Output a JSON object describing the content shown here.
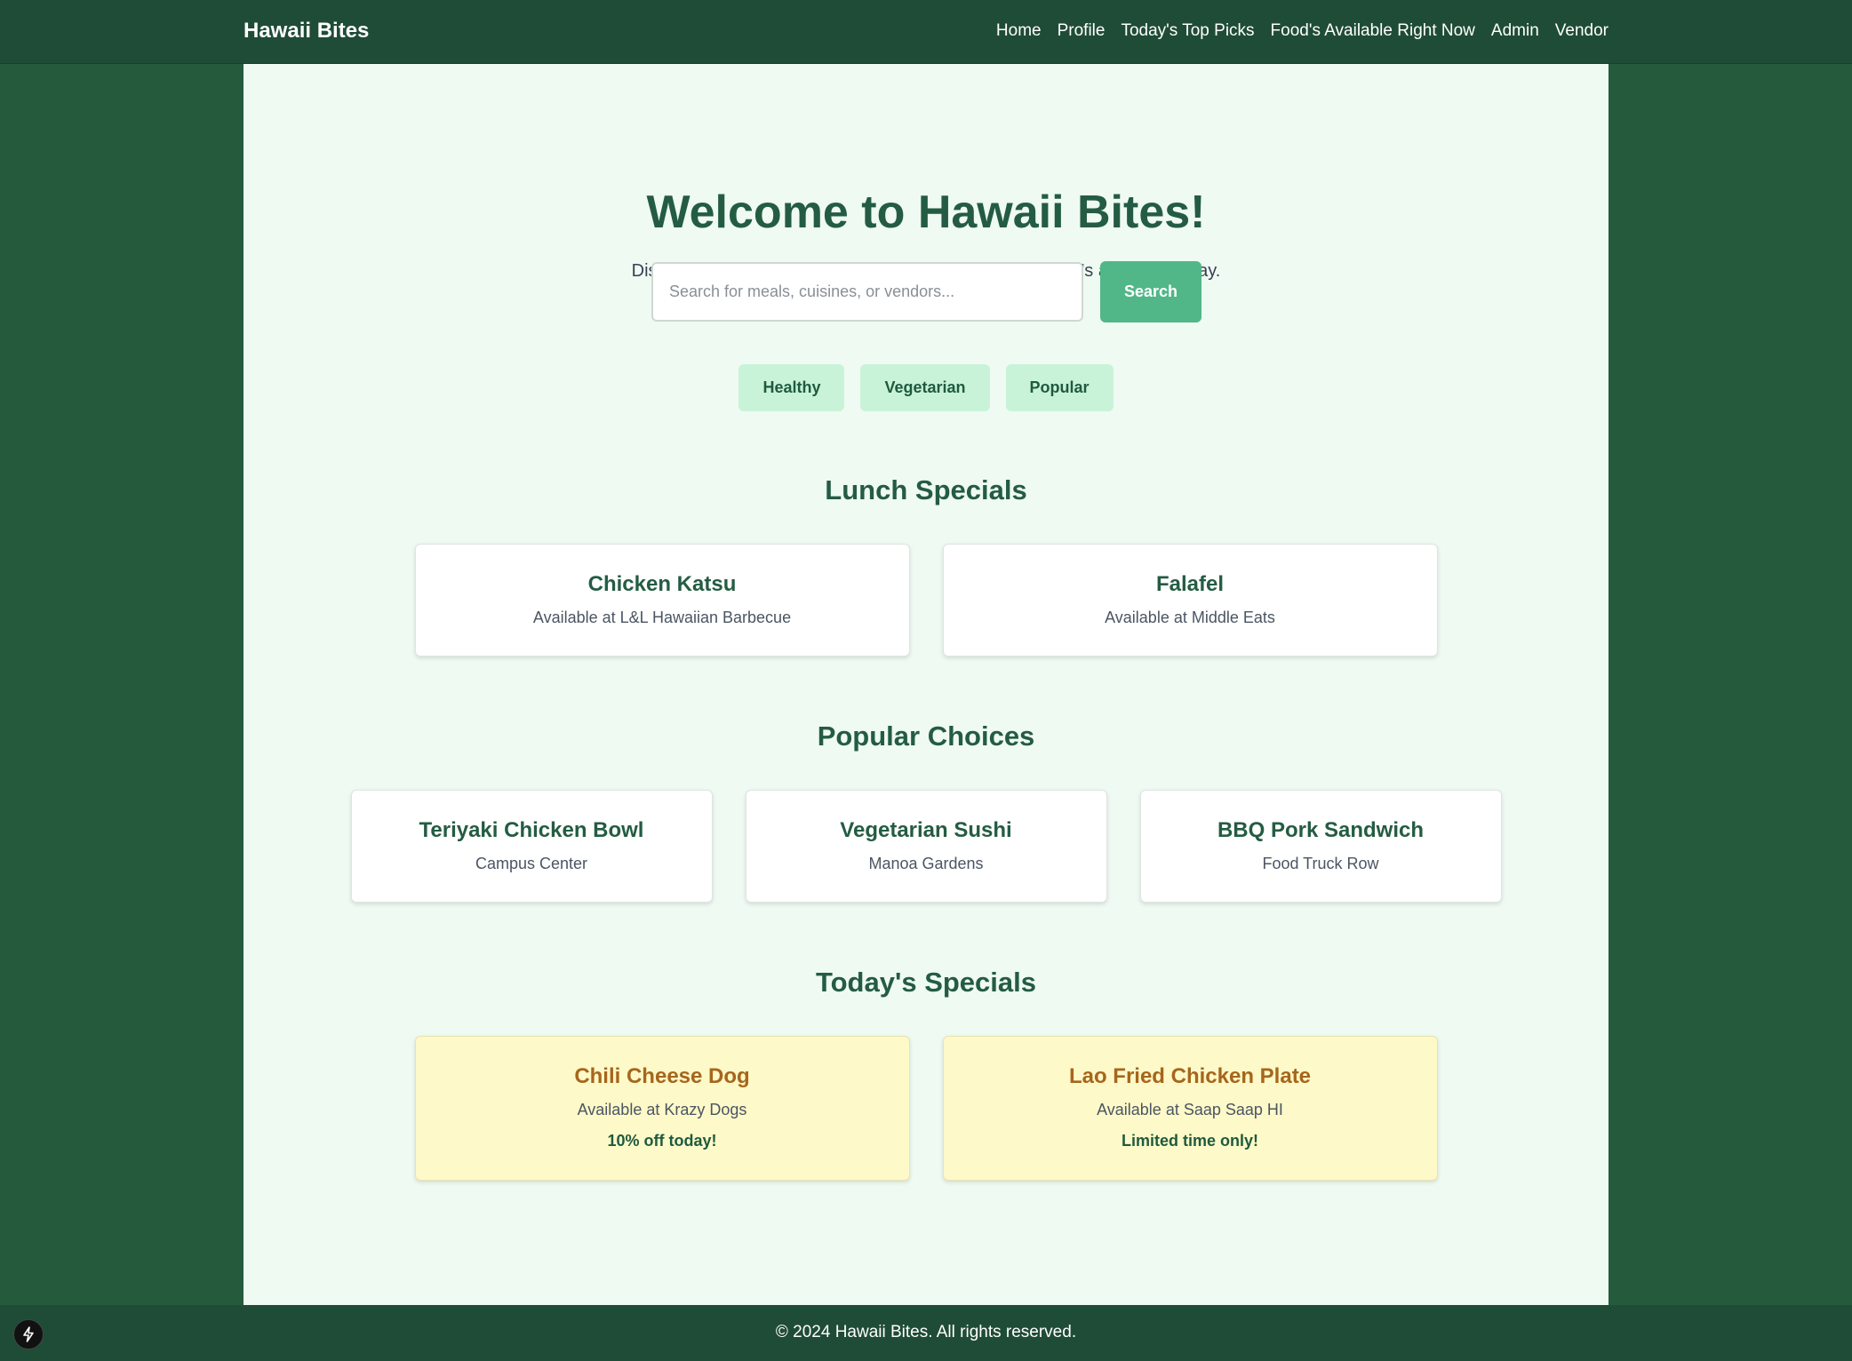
{
  "header": {
    "brand": "Hawaii Bites",
    "nav": [
      "Home",
      "Profile",
      "Today's Top Picks",
      "Food's Available Right Now",
      "Admin",
      "Vendor"
    ]
  },
  "hero": {
    "title": "Welcome to Hawaii Bites!",
    "subtitle": "Discover your favorite campus meals and check out what's available today."
  },
  "search": {
    "placeholder": "Search for meals, cuisines, or vendors...",
    "value": "",
    "button_label": "Search"
  },
  "filters": [
    "Healthy",
    "Vegetarian",
    "Popular"
  ],
  "lunch_specials": {
    "title": "Lunch Specials",
    "items": [
      {
        "name": "Chicken Katsu",
        "where": "Available at L&L Hawaiian Barbecue"
      },
      {
        "name": "Falafel",
        "where": "Available at Middle Eats"
      }
    ]
  },
  "popular_choices": {
    "title": "Popular Choices",
    "items": [
      {
        "name": "Teriyaki Chicken Bowl",
        "where": "Campus Center"
      },
      {
        "name": "Vegetarian Sushi",
        "where": "Manoa Gardens"
      },
      {
        "name": "BBQ Pork Sandwich",
        "where": "Food Truck Row"
      }
    ]
  },
  "todays_specials": {
    "title": "Today's Specials",
    "items": [
      {
        "name": "Chili Cheese Dog",
        "where": "Available at Krazy Dogs",
        "note": "10% off today!"
      },
      {
        "name": "Lao Fried Chicken Plate",
        "where": "Available at Saap Saap HI",
        "note": "Limited time only!"
      }
    ]
  },
  "footer": {
    "text": "© 2024 Hawaii Bites. All rights reserved."
  },
  "colors": {
    "page_background": "#255a3c",
    "header_background": "#1f4c36",
    "panel_background": "#effaf3",
    "primary_text": "#245c43",
    "search_button": "#52b788",
    "chip_background": "#c9f3d9",
    "special_card_background": "#fef9c8",
    "special_card_title": "#a6661c"
  },
  "icons": {
    "dev_badge": "lightning-bolt-icon"
  }
}
